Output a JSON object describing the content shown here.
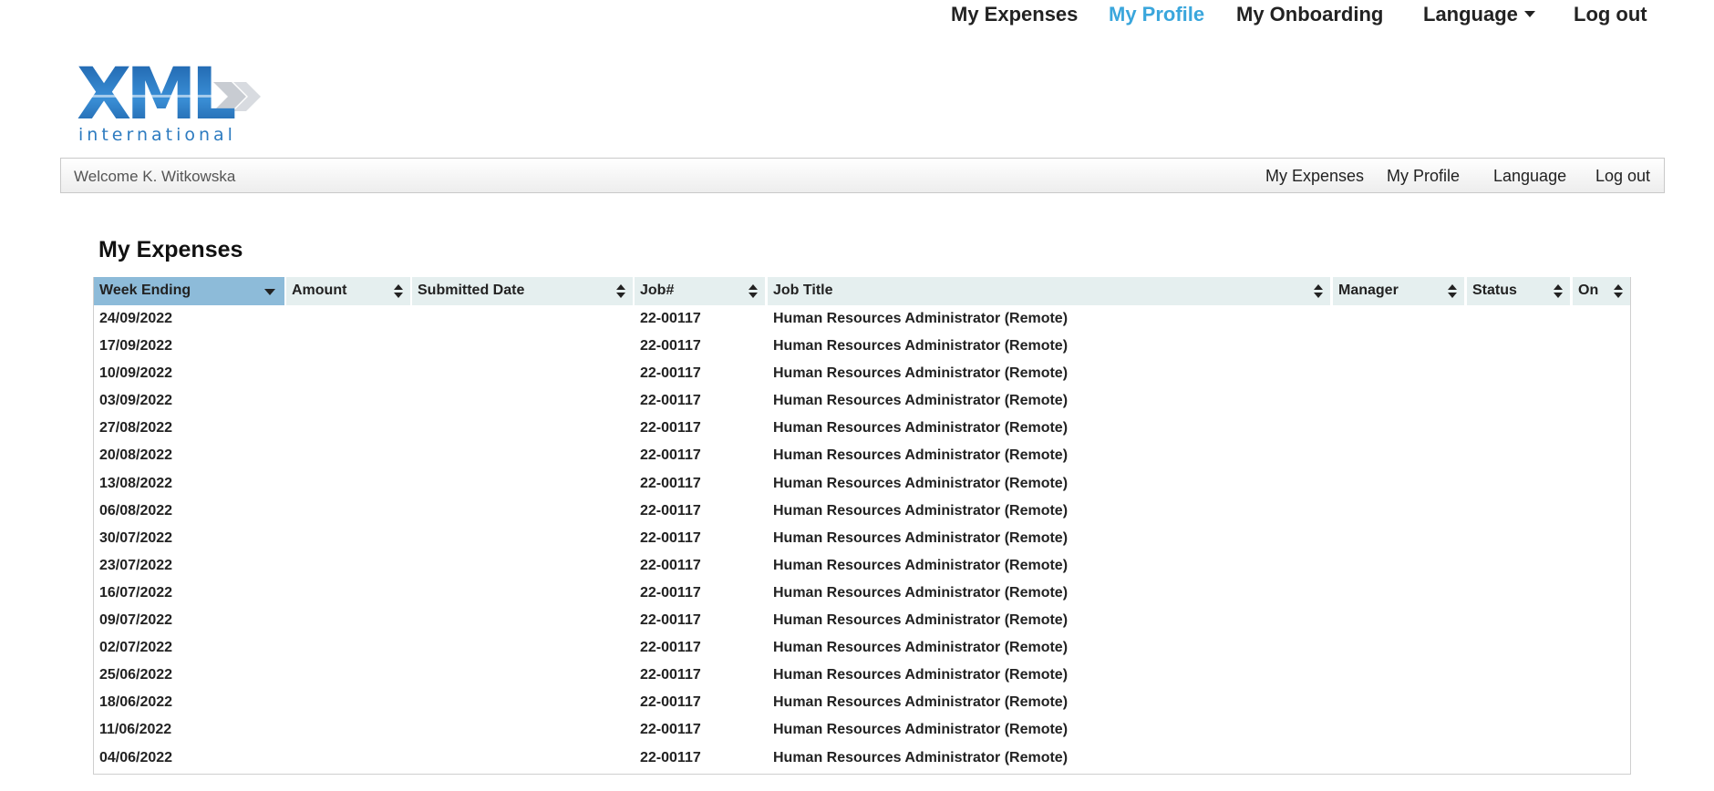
{
  "top_nav": {
    "my_expenses": "My Expenses",
    "my_profile": "My Profile",
    "my_onboarding": "My Onboarding",
    "language": "Language",
    "log_out": "Log out"
  },
  "logo": {
    "main": "XML",
    "sub": "international"
  },
  "welcome_bar": {
    "welcome": "Welcome K. Witkowska",
    "links": {
      "my_expenses": "My Expenses",
      "my_profile": "My Profile",
      "language": "Language",
      "log_out": "Log out"
    }
  },
  "page": {
    "title": "My Expenses"
  },
  "table": {
    "columns": {
      "week_ending": "Week Ending",
      "amount": "Amount",
      "submitted_date": "Submitted Date",
      "job_no": "Job#",
      "job_title": "Job Title",
      "manager": "Manager",
      "status": "Status",
      "on": "On"
    },
    "rows": [
      {
        "week": "24/09/2022",
        "job": "22-00117",
        "title": "Human Resources Administrator (Remote)"
      },
      {
        "week": "17/09/2022",
        "job": "22-00117",
        "title": "Human Resources Administrator (Remote)"
      },
      {
        "week": "10/09/2022",
        "job": "22-00117",
        "title": "Human Resources Administrator (Remote)"
      },
      {
        "week": "03/09/2022",
        "job": "22-00117",
        "title": "Human Resources Administrator (Remote)"
      },
      {
        "week": "27/08/2022",
        "job": "22-00117",
        "title": "Human Resources Administrator (Remote)"
      },
      {
        "week": "20/08/2022",
        "job": "22-00117",
        "title": "Human Resources Administrator (Remote)"
      },
      {
        "week": "13/08/2022",
        "job": "22-00117",
        "title": "Human Resources Administrator (Remote)"
      },
      {
        "week": "06/08/2022",
        "job": "22-00117",
        "title": "Human Resources Administrator (Remote)"
      },
      {
        "week": "30/07/2022",
        "job": "22-00117",
        "title": "Human Resources Administrator (Remote)"
      },
      {
        "week": "23/07/2022",
        "job": "22-00117",
        "title": "Human Resources Administrator (Remote)"
      },
      {
        "week": "16/07/2022",
        "job": "22-00117",
        "title": "Human Resources Administrator (Remote)"
      },
      {
        "week": "09/07/2022",
        "job": "22-00117",
        "title": "Human Resources Administrator (Remote)"
      },
      {
        "week": "02/07/2022",
        "job": "22-00117",
        "title": "Human Resources Administrator (Remote)"
      },
      {
        "week": "25/06/2022",
        "job": "22-00117",
        "title": "Human Resources Administrator (Remote)"
      },
      {
        "week": "18/06/2022",
        "job": "22-00117",
        "title": "Human Resources Administrator (Remote)"
      },
      {
        "week": "11/06/2022",
        "job": "22-00117",
        "title": "Human Resources Administrator (Remote)"
      },
      {
        "week": "04/06/2022",
        "job": "22-00117",
        "title": "Human Resources Administrator (Remote)"
      }
    ]
  },
  "colors": {
    "accent": "#3aa6dc",
    "sorted_header": "#8dbbd9",
    "header": "#e5efef"
  },
  "icons": {
    "sort": "sort-icon",
    "sort_desc": "sort-desc-icon",
    "dropdown": "caret-down-icon"
  }
}
